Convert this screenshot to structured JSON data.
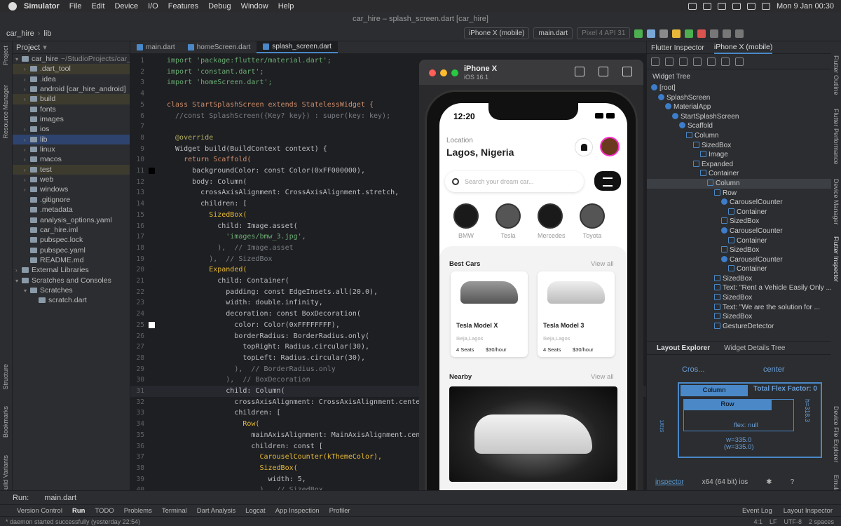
{
  "menubar": {
    "app": "Simulator",
    "items": [
      "File",
      "Edit",
      "Device",
      "I/O",
      "Features",
      "Debug",
      "Window",
      "Help"
    ],
    "datetime": "Mon 9 Jan  00:30"
  },
  "window_title": "car_hire – splash_screen.dart [car_hire]",
  "toolbar": {
    "project": "car_hire",
    "folder": "lib",
    "device": "iPhone X (mobile)",
    "run_config": "main.dart",
    "emulator": "Pixel 4 API 31"
  },
  "left_strip": [
    "Project",
    "Resource Manager",
    "Structure",
    "Bookmarks",
    "Build Variants"
  ],
  "project_panel": {
    "title": "Project",
    "tree": [
      {
        "label": "car_hire",
        "extra": "~/StudioProjects/car_",
        "depth": 0,
        "arrow": "▾",
        "hl": false
      },
      {
        "label": ".dart_tool",
        "extra": "",
        "depth": 1,
        "arrow": "›",
        "hl": true
      },
      {
        "label": ".idea",
        "extra": "",
        "depth": 1,
        "arrow": "›",
        "hl": false
      },
      {
        "label": "android [car_hire_android]",
        "extra": "",
        "depth": 1,
        "arrow": "›",
        "hl": false
      },
      {
        "label": "build",
        "extra": "",
        "depth": 1,
        "arrow": "›",
        "hl": true
      },
      {
        "label": "fonts",
        "extra": "",
        "depth": 1,
        "arrow": "",
        "hl": false
      },
      {
        "label": "images",
        "extra": "",
        "depth": 1,
        "arrow": "",
        "hl": false
      },
      {
        "label": "ios",
        "extra": "",
        "depth": 1,
        "arrow": "›",
        "hl": false
      },
      {
        "label": "lib",
        "extra": "",
        "depth": 1,
        "arrow": "›",
        "sel": true
      },
      {
        "label": "linux",
        "extra": "",
        "depth": 1,
        "arrow": "›",
        "hl": false
      },
      {
        "label": "macos",
        "extra": "",
        "depth": 1,
        "arrow": "›",
        "hl": false
      },
      {
        "label": "test",
        "extra": "",
        "depth": 1,
        "arrow": "›",
        "hl": true
      },
      {
        "label": "web",
        "extra": "",
        "depth": 1,
        "arrow": "›",
        "hl": false
      },
      {
        "label": "windows",
        "extra": "",
        "depth": 1,
        "arrow": "›",
        "hl": false
      },
      {
        "label": ".gitignore",
        "extra": "",
        "depth": 1,
        "arrow": "",
        "hl": false
      },
      {
        "label": ".metadata",
        "extra": "",
        "depth": 1,
        "arrow": "",
        "hl": false
      },
      {
        "label": "analysis_options.yaml",
        "extra": "",
        "depth": 1,
        "arrow": "",
        "hl": false
      },
      {
        "label": "car_hire.iml",
        "extra": "",
        "depth": 1,
        "arrow": "",
        "hl": false
      },
      {
        "label": "pubspec.lock",
        "extra": "",
        "depth": 1,
        "arrow": "",
        "hl": false
      },
      {
        "label": "pubspec.yaml",
        "extra": "",
        "depth": 1,
        "arrow": "",
        "hl": false
      },
      {
        "label": "README.md",
        "extra": "",
        "depth": 1,
        "arrow": "",
        "hl": false
      },
      {
        "label": "External Libraries",
        "extra": "",
        "depth": 0,
        "arrow": "›",
        "hl": false
      },
      {
        "label": "Scratches and Consoles",
        "extra": "",
        "depth": 0,
        "arrow": "▾",
        "hl": false
      },
      {
        "label": "Scratches",
        "extra": "",
        "depth": 1,
        "arrow": "▾",
        "hl": false
      },
      {
        "label": "scratch.dart",
        "extra": "",
        "depth": 2,
        "arrow": "",
        "hl": false
      }
    ]
  },
  "tabs": [
    "main.dart",
    "homeScreen.dart",
    "splash_screen.dart"
  ],
  "code_lines": [
    {
      "n": "1",
      "t": "import 'package:flutter/material.dart';",
      "c": "st",
      "i": 0
    },
    {
      "n": "2",
      "t": "import 'constant.dart';",
      "c": "st",
      "i": 0
    },
    {
      "n": "3",
      "t": "import 'homeScreen.dart';",
      "c": "st",
      "i": 0
    },
    {
      "n": "4",
      "t": "",
      "c": "",
      "i": 0
    },
    {
      "n": "5",
      "t": "class StartSplashScreen extends StatelessWidget {",
      "c": "kw",
      "i": 0
    },
    {
      "n": "6",
      "t": "  //const SplashScreen({Key? key}) : super(key: key);",
      "c": "cm",
      "i": 0
    },
    {
      "n": "7",
      "t": "",
      "c": "",
      "i": 0
    },
    {
      "n": "8",
      "t": "  @override",
      "c": "an",
      "i": 0
    },
    {
      "n": "9",
      "t": "  Widget build(BuildContext context) {",
      "c": "",
      "i": 0
    },
    {
      "n": "10",
      "t": "    return Scaffold(",
      "c": "kw",
      "i": 0
    },
    {
      "n": "11",
      "t": "      backgroundColor: const Color(0xFF000000),",
      "c": "",
      "i": 0
    },
    {
      "n": "12",
      "t": "      body: Column(",
      "c": "",
      "i": 0
    },
    {
      "n": "13",
      "t": "        crossAxisAlignment: CrossAxisAlignment.stretch,",
      "c": "",
      "i": 0
    },
    {
      "n": "14",
      "t": "        children: [",
      "c": "",
      "i": 0
    },
    {
      "n": "15",
      "t": "          SizedBox(",
      "c": "fn",
      "i": 0
    },
    {
      "n": "16",
      "t": "            child: Image.asset(",
      "c": "",
      "i": 0
    },
    {
      "n": "17",
      "t": "              'images/bmw_3.jpg',",
      "c": "st",
      "i": 0
    },
    {
      "n": "18",
      "t": "            ),  // Image.asset",
      "c": "cm",
      "i": 0
    },
    {
      "n": "19",
      "t": "          ),  // SizedBox",
      "c": "cm",
      "i": 0
    },
    {
      "n": "20",
      "t": "          Expanded(",
      "c": "fn",
      "i": 0
    },
    {
      "n": "21",
      "t": "            child: Container(",
      "c": "",
      "i": 0
    },
    {
      "n": "22",
      "t": "              padding: const EdgeInsets.all(20.0),",
      "c": "",
      "i": 0
    },
    {
      "n": "23",
      "t": "              width: double.infinity,",
      "c": "",
      "i": 0
    },
    {
      "n": "24",
      "t": "              decoration: const BoxDecoration(",
      "c": "",
      "i": 0
    },
    {
      "n": "25",
      "t": "                color: Color(0xFFFFFFFF),",
      "c": "",
      "i": 0
    },
    {
      "n": "26",
      "t": "                borderRadius: BorderRadius.only(",
      "c": "",
      "i": 0
    },
    {
      "n": "27",
      "t": "                  topRight: Radius.circular(30),",
      "c": "",
      "i": 0
    },
    {
      "n": "28",
      "t": "                  topLeft: Radius.circular(30),",
      "c": "",
      "i": 0
    },
    {
      "n": "29",
      "t": "                ),  // BorderRadius.only",
      "c": "cm",
      "i": 0
    },
    {
      "n": "30",
      "t": "              ),  // BoxDecoration",
      "c": "cm",
      "i": 0
    },
    {
      "n": "31",
      "t": "              child: Column(",
      "c": "",
      "i": 0
    },
    {
      "n": "32",
      "t": "                crossAxisAlignment: CrossAxisAlignment.center,",
      "c": "",
      "i": 0
    },
    {
      "n": "33",
      "t": "                children: [",
      "c": "",
      "i": 0
    },
    {
      "n": "34",
      "t": "                  Row(",
      "c": "fn",
      "i": 0
    },
    {
      "n": "35",
      "t": "                    mainAxisAlignment: MainAxisAlignment.center,",
      "c": "",
      "i": 0
    },
    {
      "n": "36",
      "t": "                    children: const [",
      "c": "",
      "i": 0
    },
    {
      "n": "37",
      "t": "                      CarouselCounter(kThemeColor),",
      "c": "fn",
      "i": 0
    },
    {
      "n": "38",
      "t": "                      SizedBox(",
      "c": "fn",
      "i": 0
    },
    {
      "n": "39",
      "t": "                        width: 5,",
      "c": "",
      "i": 0
    },
    {
      "n": "40",
      "t": "                      ),  // SizedBox",
      "c": "cm",
      "i": 0
    }
  ],
  "simulator": {
    "name": "iPhone X",
    "os": "iOS 16.1"
  },
  "app": {
    "time": "12:20",
    "location_label": "Location",
    "location": "Lagos, Nigeria",
    "search_placeholder": "Search your dream car...",
    "brands": [
      "BMW",
      "Tesla",
      "Mercedes",
      "Toyota"
    ],
    "best_cars": "Best Cars",
    "view_all": "View all",
    "cars": [
      {
        "name": "Tesla Model X",
        "location": "Ikeja,Lagos",
        "seats": "4 Seats",
        "price": "$30/hour"
      },
      {
        "name": "Tesla Model 3",
        "location": "Ikeja,Lagos",
        "seats": "4 Seats",
        "price": "$30/hour"
      }
    ],
    "nearby": "Nearby"
  },
  "inspector": {
    "tabs": [
      "Flutter Inspector",
      "iPhone X (mobile)"
    ],
    "widget_tree_title": "Widget Tree",
    "tree": [
      {
        "label": "[root]",
        "d": 0
      },
      {
        "label": "SplashScreen",
        "d": 1
      },
      {
        "label": "MaterialApp",
        "d": 2
      },
      {
        "label": "StartSplashScreen",
        "d": 3
      },
      {
        "label": "Scaffold",
        "d": 4
      },
      {
        "label": "Column",
        "d": 5
      },
      {
        "label": "SizedBox",
        "d": 6
      },
      {
        "label": "Image",
        "d": 7
      },
      {
        "label": "Expanded",
        "d": 6
      },
      {
        "label": "Container",
        "d": 7
      },
      {
        "label": "Column",
        "d": 8,
        "sel": true
      },
      {
        "label": "Row",
        "d": 9
      },
      {
        "label": "CarouselCounter",
        "d": 10
      },
      {
        "label": "Container",
        "d": 11
      },
      {
        "label": "SizedBox",
        "d": 10
      },
      {
        "label": "CarouselCounter",
        "d": 10
      },
      {
        "label": "Container",
        "d": 11
      },
      {
        "label": "SizedBox",
        "d": 10
      },
      {
        "label": "CarouselCounter",
        "d": 10
      },
      {
        "label": "Container",
        "d": 11
      },
      {
        "label": "SizedBox",
        "d": 9
      },
      {
        "label": "Text: \"Rent a Vehicle Easily Only ...",
        "d": 9
      },
      {
        "label": "SizedBox",
        "d": 9
      },
      {
        "label": "Text: \"We are the solution for ...",
        "d": 9
      },
      {
        "label": "SizedBox",
        "d": 9
      },
      {
        "label": "GestureDetector",
        "d": 9
      }
    ],
    "layout_tabs": [
      "Layout Explorer",
      "Widget Details Tree"
    ],
    "cross": "Cros...",
    "center": "center",
    "column": "Column",
    "total_flex": "Total Flex Factor: 0",
    "row": "Row",
    "flex": "flex: null",
    "w": "w=335.0",
    "w2": "(w=335.0)",
    "h": "h=318.3",
    "start": "start",
    "inspector_link": "inspector",
    "arch": "x64 (64 bit) ios"
  },
  "right_strip": [
    "Flutter Outline",
    "Flutter Performance",
    "Device Manager",
    "Flutter Inspector",
    "Device File Explorer",
    "Emulator"
  ],
  "run_bar": {
    "label": "Run:",
    "config": "main.dart"
  },
  "bottom_tabs": [
    "Version Control",
    "Run",
    "TODO",
    "Problems",
    "Terminal",
    "Dart Analysis",
    "Logcat",
    "App Inspection",
    "Profiler"
  ],
  "bottom_right": [
    "Event Log",
    "Layout Inspector"
  ],
  "status": {
    "message": "* daemon started successfully (yesterday 22:54)",
    "right": [
      "4:1",
      "LF",
      "UTF-8",
      "2 spaces"
    ]
  }
}
